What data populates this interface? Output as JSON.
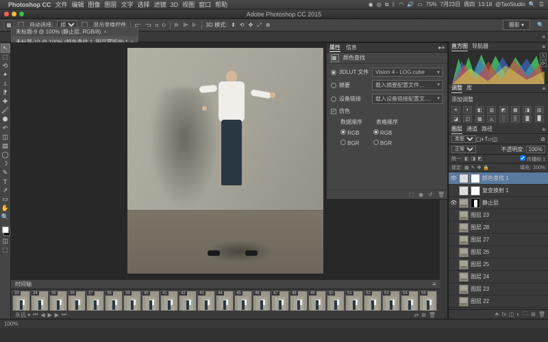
{
  "mac_menu": {
    "app_name": "Photoshop CC",
    "items": [
      "文件",
      "编辑",
      "图像",
      "图层",
      "文字",
      "选择",
      "滤镜",
      "3D",
      "视图",
      "窗口",
      "帮助"
    ],
    "right_status": {
      "wifi": true,
      "bluetooth": true,
      "volume": true,
      "battery_pct": "75%",
      "date": "7月23日",
      "day": "周四",
      "time": "13:18",
      "user": "@TaoStudio",
      "search": true
    }
  },
  "window": {
    "title": "Adobe Photoshop CC 2015"
  },
  "options_bar": {
    "auto_select_label": "自动选择:",
    "auto_select_value": "组",
    "show_transform_label": "显示变换控件",
    "d3_mode_label": "3D 模式:",
    "camera_label": "摄影"
  },
  "tabs": [
    {
      "label": "未标题-9 @ 100% (静止层, RGB/8)",
      "active": false
    },
    {
      "label": "未标题-10 @ 100% (颜色查找 1, 图层蒙版/8) *",
      "active": true
    }
  ],
  "tools": [
    "move",
    "marquee",
    "lasso",
    "wand",
    "crop",
    "eyedrop",
    "heal",
    "brush",
    "stamp",
    "history",
    "eraser",
    "gradient",
    "blur",
    "dodge",
    "pen",
    "type",
    "path",
    "shape",
    "hand",
    "zoom"
  ],
  "float_panel": {
    "tabs": [
      "属性",
      "信息"
    ],
    "title": "颜色查找",
    "rows": {
      "lut_label": "3DLUT 文件",
      "lut_value": "Vision 4 - LOG.cube",
      "abstract_label": "摘要",
      "abstract_value": "载入摘要配置文件…",
      "device_label": "设备链接",
      "device_value": "载入设备链接配置文…",
      "dither_label": "仿色",
      "data_order_label": "数据顺序",
      "table_order_label": "表格顺序",
      "rgb": "RGB",
      "bgr": "BGR"
    }
  },
  "right": {
    "histogram_tabs": [
      "直方图",
      "导航器"
    ],
    "adjustments_tabs": [
      "调整",
      "库"
    ],
    "adjustments_title": "添加调整",
    "adjustments_icons": [
      "☀",
      "◐",
      "◧",
      "▥",
      "◩",
      "▦",
      "◨",
      "▤",
      "◪",
      "◫",
      "▩",
      "◬",
      "░",
      "▒",
      "▓",
      "█"
    ],
    "layers_tabs": [
      "图层",
      "通道",
      "路径"
    ],
    "blend_mode": "正常",
    "opacity_label": "不透明度:",
    "opacity_value": "100%",
    "lock_label": "锁定:",
    "fill_label": "填充:",
    "fill_value": "100%",
    "type_label": "类型",
    "propagate_label": "传播帧 1",
    "unify_label": "统一:",
    "layers": [
      {
        "visible": true,
        "name": "颜色查找 1",
        "adj": true,
        "mask": "white",
        "selected": true
      },
      {
        "visible": false,
        "name": "复变换射 1",
        "adj": true,
        "mask": "white"
      },
      {
        "visible": true,
        "name": "静止层",
        "mask": "silhouette"
      },
      {
        "visible": false,
        "name": "图层 23"
      },
      {
        "visible": false,
        "name": "图层 28"
      },
      {
        "visible": false,
        "name": "图层 27"
      },
      {
        "visible": false,
        "name": "图层 26"
      },
      {
        "visible": false,
        "name": "图层 25"
      },
      {
        "visible": false,
        "name": "图层 24"
      },
      {
        "visible": false,
        "name": "图层 23"
      },
      {
        "visible": false,
        "name": "图层 22"
      }
    ]
  },
  "timeline": {
    "title": "时间轴",
    "frames": [
      {
        "n": 33,
        "d": "0.04"
      },
      {
        "n": 34,
        "d": "0.04"
      },
      {
        "n": 35,
        "d": "0.04"
      },
      {
        "n": 36,
        "d": "0.04"
      },
      {
        "n": 37,
        "d": "0.04"
      },
      {
        "n": 38,
        "d": "0.04"
      },
      {
        "n": 39,
        "d": "0.04"
      },
      {
        "n": 40,
        "d": "0.04"
      },
      {
        "n": 41,
        "d": "0.04"
      },
      {
        "n": 42,
        "d": "0.04"
      },
      {
        "n": 43,
        "d": "0.04"
      },
      {
        "n": 44,
        "d": "0.04"
      },
      {
        "n": 45,
        "d": "0.04"
      },
      {
        "n": 46,
        "d": "0.04"
      },
      {
        "n": 47,
        "d": "0.04"
      },
      {
        "n": 48,
        "d": "0.04"
      },
      {
        "n": 49,
        "d": "0.04"
      },
      {
        "n": 50,
        "d": "0.04"
      },
      {
        "n": 51,
        "d": "0.04"
      },
      {
        "n": 52,
        "d": "0.04"
      },
      {
        "n": 53,
        "d": "0.04"
      },
      {
        "n": 54,
        "d": "0.04"
      },
      {
        "n": 55,
        "d": "0.04"
      }
    ],
    "loop_label": "永远"
  },
  "status": {
    "zoom": "100%"
  }
}
